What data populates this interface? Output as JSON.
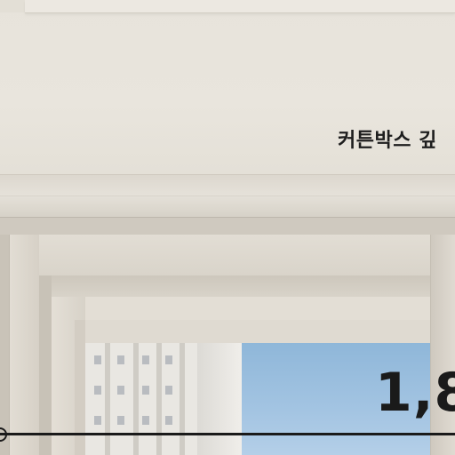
{
  "labels": {
    "curtain_box": "커튼박스 깊",
    "dimension_value": "1,8"
  },
  "colors": {
    "wall": "#e8e4dc",
    "sky": "#a3c4e2",
    "text": "#1a1a1a"
  }
}
